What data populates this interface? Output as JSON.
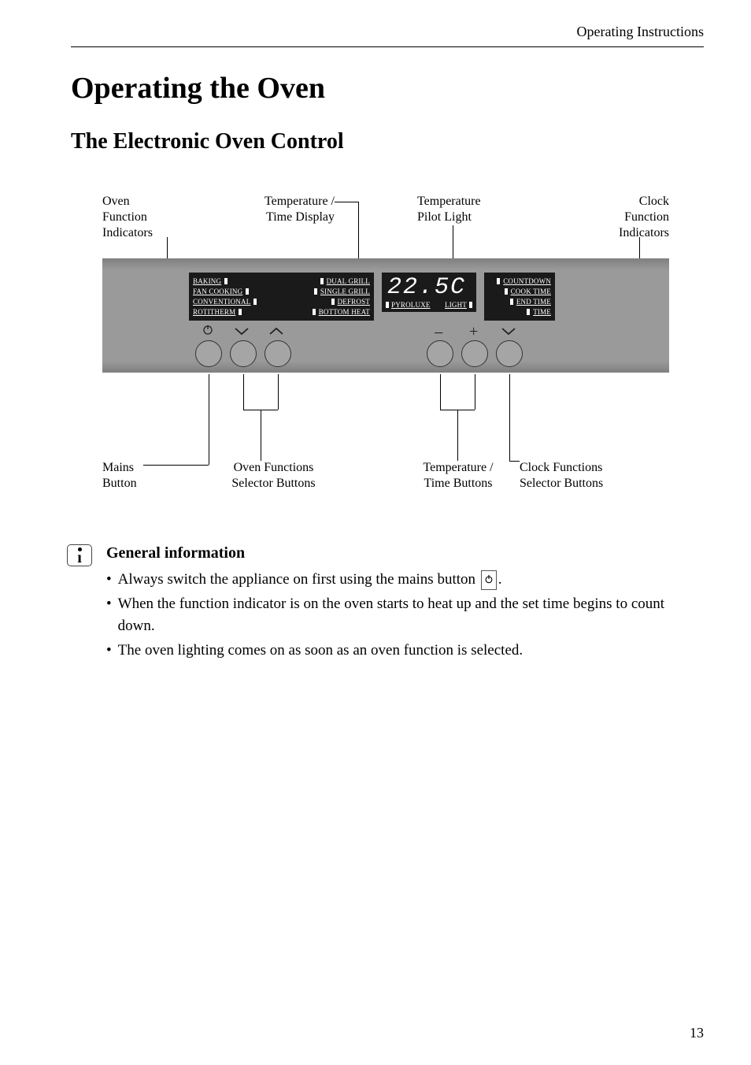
{
  "header": {
    "section": "Operating Instructions"
  },
  "title": "Operating the Oven",
  "subtitle": "The Electronic Oven Control",
  "diagram": {
    "labels": {
      "oven_function_indicators": "Oven\nFunction\nIndicators",
      "temp_time_display": "Temperature /\nTime Display",
      "temp_pilot_light": "Temperature\nPilot Light",
      "clock_function_indicators": "Clock\nFunction\nIndicators",
      "mains_button": "Mains\nButton",
      "oven_functions_selector": "Oven Functions\nSelector Buttons",
      "temp_time_buttons": "Temperature /\nTime Buttons",
      "clock_functions_selector": "Clock Functions\nSelector Buttons"
    },
    "panel": {
      "left_top": [
        "BAKING",
        "FAN COOKING",
        "CONVENTIONAL",
        "ROTITHERM"
      ],
      "left_bot": [
        "DUAL GRILL",
        "SINGLE GRILL",
        "DEFROST",
        "BOTTOM HEAT"
      ],
      "right_top": [
        "COUNTDOWN",
        "COOK TIME",
        "END TIME",
        "TIME"
      ],
      "temp_value": "22.5C",
      "temp_labels": [
        "PYROLUXE",
        "LIGHT"
      ]
    }
  },
  "info": {
    "heading": "General information",
    "items": [
      "Always switch the appliance on first using the mains button {POWER}.",
      "When the function indicator is on the oven starts to heat up and the set time begins to count down.",
      "The oven lighting comes on as soon as an oven function is selected."
    ]
  },
  "page_number": "13"
}
